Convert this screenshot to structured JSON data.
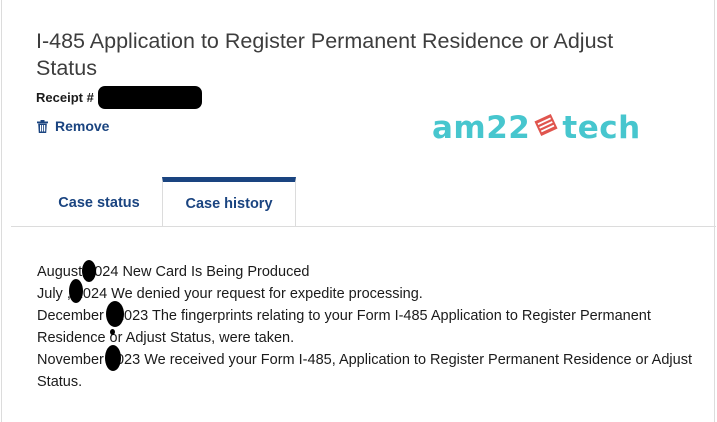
{
  "case": {
    "title": "I-485 Application to Register Permanent Residence or Adjust Status",
    "receipt_label": "Receipt #",
    "remove_label": "Remove"
  },
  "logo": {
    "left_text": "am22",
    "right_text": "tech",
    "color": "#47c6ce",
    "mark_color": "#e0554e"
  },
  "tabs": [
    {
      "label": "Case status",
      "active": false
    },
    {
      "label": "Case history",
      "active": true
    }
  ],
  "history": [
    "August   2024 New Card Is Being Produced",
    "July  , 2024 We denied your request for expedite processing.",
    "December  , 2023 The fingerprints relating to your Form I-485 Application to Register Permanent Residence or Adjust Status, were taken.",
    "November   2023 We received your Form I-485, Application to Register Permanent Residence or Adjust Status."
  ],
  "colors": {
    "link": "#1a4480",
    "title": "#3d3d3d",
    "border": "#dcdcdc"
  }
}
